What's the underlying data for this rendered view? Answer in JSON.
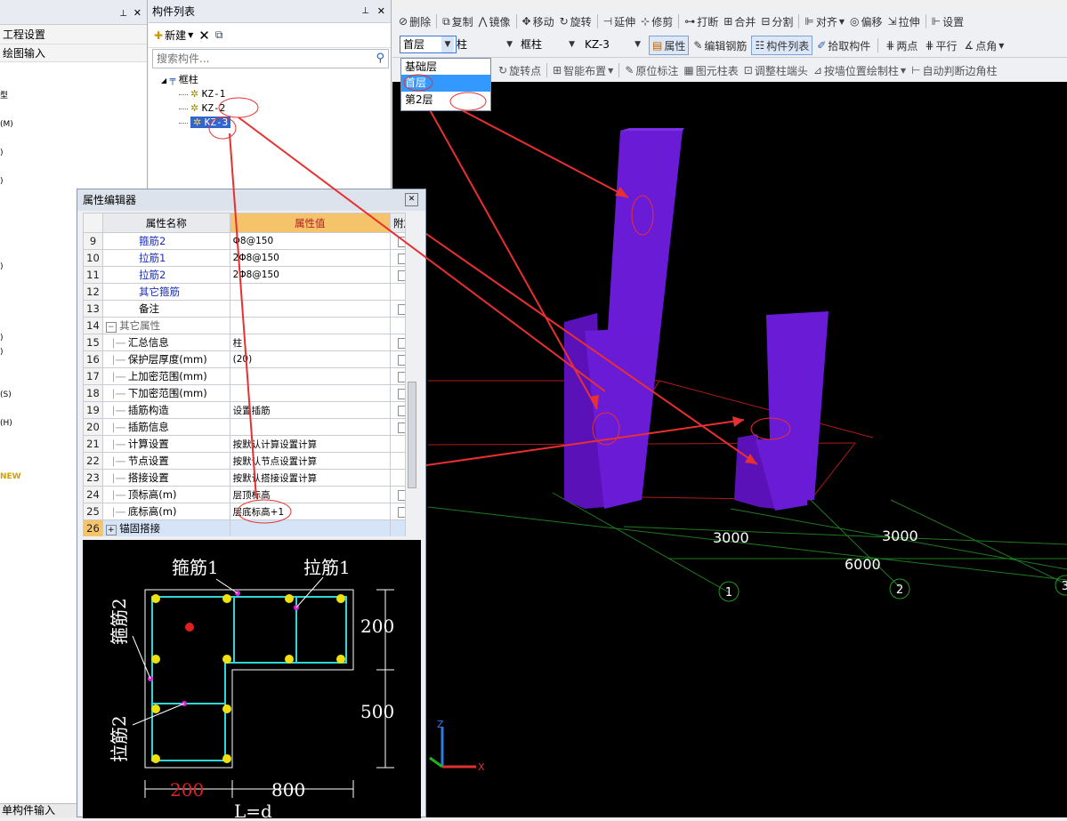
{
  "left_panel": {
    "items": [
      "工程设置",
      "绘图输入"
    ],
    "side_marks": [
      "型",
      "(M)",
      ")",
      ")",
      ")",
      ")",
      ")",
      "(S)",
      "(H)",
      "NEW"
    ],
    "bottom_label": "单构件输入"
  },
  "component_list": {
    "title": "构件列表",
    "new_label": "新建",
    "search_placeholder": "搜索构件...",
    "tree": {
      "root": "框柱",
      "items": [
        "KZ-1",
        "KZ-2",
        "KZ-3"
      ],
      "selected": "KZ-3"
    }
  },
  "toolbar1": [
    "删除",
    "复制",
    "镜像",
    "移动",
    "旋转",
    "延伸",
    "修剪",
    "打断",
    "合并",
    "分割",
    "对齐",
    "偏移",
    "拉伸",
    "设置"
  ],
  "toolbar2": {
    "floor": "首层",
    "type": "柱",
    "subtype": "框柱",
    "name": "KZ-3",
    "buttons": [
      "属性",
      "编辑钢筋",
      "构件列表",
      "拾取构件",
      "两点",
      "平行",
      "点角"
    ]
  },
  "floor_dropdown": {
    "options": [
      "基础层",
      "首层",
      "第2层"
    ],
    "selected": "首层"
  },
  "toolbar3": [
    "旋转点",
    "智能布置",
    "原位标注",
    "图元柱表",
    "调整柱端头",
    "按墙位置绘制柱",
    "自动判断边角柱"
  ],
  "prop_editor": {
    "title": "属性编辑器",
    "headers": [
      "属性名称",
      "属性值",
      "附加"
    ],
    "rows": [
      {
        "n": "9",
        "k": "箍筋2",
        "v": "Φ8@150",
        "style": "blue",
        "chk": true
      },
      {
        "n": "10",
        "k": "拉筋1",
        "v": "2Φ8@150",
        "style": "blue",
        "chk": true
      },
      {
        "n": "11",
        "k": "拉筋2",
        "v": "2Φ8@150",
        "style": "blue",
        "chk": true
      },
      {
        "n": "12",
        "k": "其它箍筋",
        "v": "",
        "style": "blue",
        "chk": false
      },
      {
        "n": "13",
        "k": "备注",
        "v": "",
        "style": "",
        "chk": true
      },
      {
        "n": "14",
        "k": "其它属性",
        "v": "",
        "style": "group",
        "chk": false
      },
      {
        "n": "15",
        "k": "汇总信息",
        "v": "柱",
        "style": "sub",
        "chk": true
      },
      {
        "n": "16",
        "k": "保护层厚度(mm)",
        "v": "(20)",
        "style": "sub",
        "chk": true
      },
      {
        "n": "17",
        "k": "上加密范围(mm)",
        "v": "",
        "style": "sub",
        "chk": true
      },
      {
        "n": "18",
        "k": "下加密范围(mm)",
        "v": "",
        "style": "sub",
        "chk": true
      },
      {
        "n": "19",
        "k": "插筋构造",
        "v": "设置插筋",
        "style": "sub",
        "chk": true
      },
      {
        "n": "20",
        "k": "插筋信息",
        "v": "",
        "style": "sub",
        "chk": true
      },
      {
        "n": "21",
        "k": "计算设置",
        "v": "按默认计算设置计算",
        "style": "sub",
        "chk": false
      },
      {
        "n": "22",
        "k": "节点设置",
        "v": "按默认节点设置计算",
        "style": "sub",
        "chk": false
      },
      {
        "n": "23",
        "k": "搭接设置",
        "v": "按默认搭接设置计算",
        "style": "sub",
        "chk": false
      },
      {
        "n": "24",
        "k": "顶标高(m)",
        "v": "层顶标高",
        "style": "sub",
        "chk": true
      },
      {
        "n": "25",
        "k": "底标高(m)",
        "v": "层底标高+1",
        "style": "sub",
        "chk": true
      },
      {
        "n": "26",
        "k": "锚固搭接",
        "v": "",
        "style": "expand",
        "chk": false
      }
    ]
  },
  "section": {
    "labels": {
      "gujin1": "箍筋1",
      "lajin1": "拉筋1",
      "gujin2": "箍筋2",
      "lajin2": "拉筋2"
    },
    "dims": {
      "d200r": "200",
      "d500": "500",
      "d200b": "200",
      "d800": "800",
      "ld": "L=d"
    }
  },
  "viewport": {
    "dims": [
      "3000",
      "3000",
      "6000"
    ],
    "axes": [
      "1",
      "2",
      "3"
    ],
    "side_dim": "3000"
  },
  "colors": {
    "column": "#6a1bd6",
    "viewport_bg": "#000000",
    "grid_red": "#c01818",
    "grid_green": "#1f7a1f",
    "annotation": "#e83030"
  }
}
